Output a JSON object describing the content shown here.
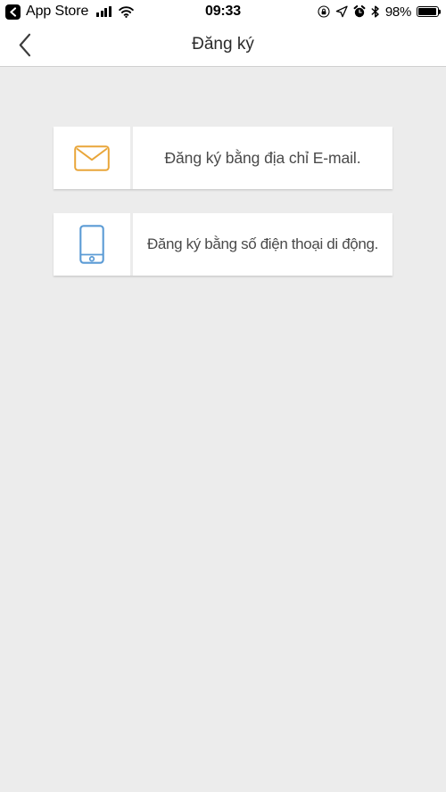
{
  "status_bar": {
    "back_badge_icon": "chevron-left-icon",
    "carrier_label": "App Store",
    "signal_icon": "cellular-signal-icon",
    "wifi_icon": "wifi-icon",
    "time": "09:33",
    "rotation_lock_icon": "rotation-lock-icon",
    "location_icon": "location-arrow-icon",
    "alarm_icon": "alarm-clock-icon",
    "bluetooth_icon": "bluetooth-icon",
    "battery_percent": "98%",
    "battery_icon": "battery-icon"
  },
  "nav_bar": {
    "back_icon": "chevron-left-icon",
    "title": "Đăng ký"
  },
  "options": [
    {
      "icon": "envelope-icon",
      "icon_color": "#e9a63a",
      "label": "Đăng ký bằng địa chỉ E-mail."
    },
    {
      "icon": "mobile-phone-icon",
      "icon_color": "#5b9bd5",
      "label": "Đăng ký bằng số điện thoại di động."
    }
  ],
  "theme": {
    "background": "#ececec",
    "card_background": "#ffffff",
    "text_color": "#4a4a4a",
    "title_color": "#2b2b2b"
  }
}
